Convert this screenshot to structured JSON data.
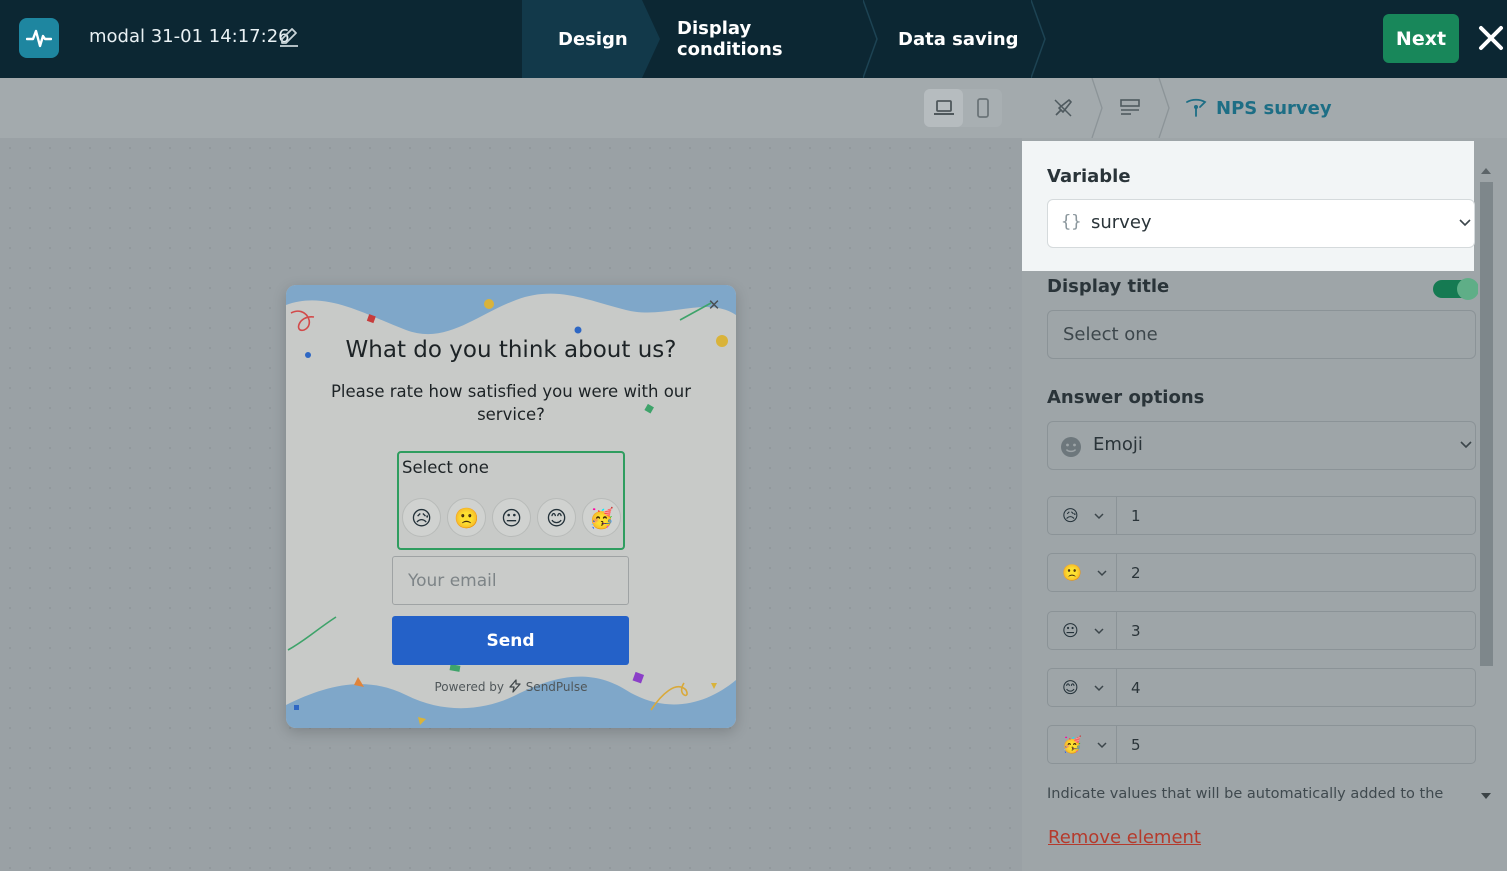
{
  "header": {
    "title": "modal 31-01 14:17:26",
    "steps": [
      {
        "label": "Design",
        "active": true
      },
      {
        "label": "Display conditions",
        "active": false
      },
      {
        "label": "Data saving",
        "active": false
      }
    ],
    "next_label": "Next"
  },
  "canvas": {
    "device_modes": [
      "desktop-icon",
      "mobile-icon"
    ],
    "active_device": "desktop-icon"
  },
  "modal": {
    "title": "What do you think about us?",
    "subtitle": "Please rate how satisfied you were with our service?",
    "select_label": "Select one",
    "emojis": [
      "😥",
      "🙁",
      "😐",
      "😊",
      "🥳"
    ],
    "email_placeholder": "Your email",
    "send_label": "Send",
    "powered_prefix": "Powered by",
    "powered_brand": "SendPulse"
  },
  "panel": {
    "breadcrumb": {
      "current": "NPS survey"
    },
    "variable_label": "Variable",
    "variable_value": "survey",
    "display_title_label": "Display title",
    "display_title_enabled": true,
    "display_title_placeholder": "Select one",
    "answer_options_label": "Answer options",
    "answer_options_value": "Emoji",
    "options": [
      {
        "emoji": "😥",
        "value": "1"
      },
      {
        "emoji": "🙁",
        "value": "2"
      },
      {
        "emoji": "😐",
        "value": "3"
      },
      {
        "emoji": "😊",
        "value": "4"
      },
      {
        "emoji": "🥳",
        "value": "5"
      }
    ],
    "hint": "Indicate values that will be automatically added to the",
    "remove_label": "Remove element"
  },
  "colors": {
    "topbar": "#0c2733",
    "accent_green": "#18875a",
    "send_blue": "#2461c8",
    "link_teal": "#1d6e85",
    "remove_red": "#b53a2c"
  }
}
